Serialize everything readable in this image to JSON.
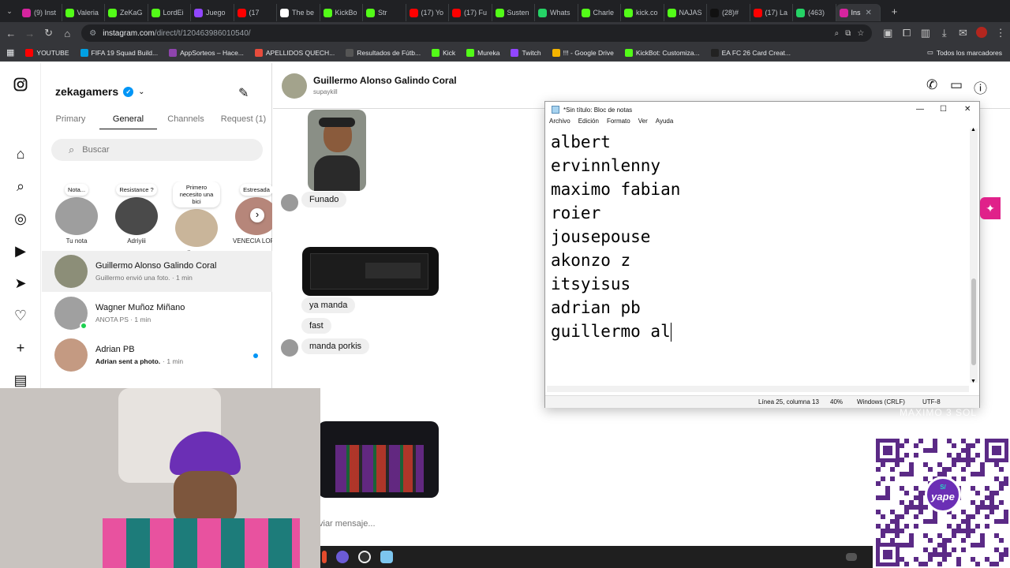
{
  "browser": {
    "tabs": [
      {
        "label": "(9) Inst",
        "color": "#d6249f"
      },
      {
        "label": "Valeria",
        "color": "#53fc18"
      },
      {
        "label": "ZeKaG",
        "color": "#53fc18"
      },
      {
        "label": "LordEi",
        "color": "#53fc18"
      },
      {
        "label": "Juego",
        "color": "#9146ff"
      },
      {
        "label": "(17",
        "color": "#ff0000"
      },
      {
        "label": "The be",
        "color": "#ffffff"
      },
      {
        "label": "KickBo",
        "color": "#53fc18"
      },
      {
        "label": "Str",
        "color": "#53fc18"
      },
      {
        "label": "(17) Yo",
        "color": "#ff0000"
      },
      {
        "label": "(17) Fu",
        "color": "#ff0000"
      },
      {
        "label": "Susten",
        "color": "#53fc18"
      },
      {
        "label": "Whats",
        "color": "#25d366"
      },
      {
        "label": "Charle",
        "color": "#53fc18"
      },
      {
        "label": "kick.co",
        "color": "#53fc18"
      },
      {
        "label": "NAJAS",
        "color": "#53fc18"
      },
      {
        "label": "(28)#",
        "color": "#111111"
      },
      {
        "label": "(17) La",
        "color": "#ff0000"
      },
      {
        "label": "(463)",
        "color": "#25d366"
      },
      {
        "label": "Ins",
        "color": "#d6249f",
        "active": true
      }
    ],
    "url_host": "instagram.com",
    "url_path": "/direct/t/120463986010540/",
    "bookmarks": [
      {
        "label": "YOUTUBE",
        "color": "#ff0000"
      },
      {
        "label": "FIFA 19 Squad Build...",
        "color": "#00a0e3"
      },
      {
        "label": "AppSorteos – Hace...",
        "color": "#8e44ad"
      },
      {
        "label": "APELLIDOS QUECH...",
        "color": "#e74c3c"
      },
      {
        "label": "Resultados de Fútb...",
        "color": "#555555"
      },
      {
        "label": "Kick",
        "color": "#53fc18"
      },
      {
        "label": "Mureka",
        "color": "#53fc18"
      },
      {
        "label": "Twitch",
        "color": "#9146ff"
      },
      {
        "label": "!!! - Google Drive",
        "color": "#f4b400"
      },
      {
        "label": "KickBot: Customiza...",
        "color": "#53fc18"
      },
      {
        "label": "EA FC 26 Card Creat...",
        "color": "#222222"
      }
    ],
    "bookmarks_folder": "Todos los marcadores"
  },
  "inbox": {
    "username": "zekagamers",
    "tabs": [
      "Primary",
      "General",
      "Channels",
      "Request (1)"
    ],
    "active_tab": "General",
    "search_placeholder": "Buscar",
    "notes": [
      {
        "bubble": "Nota...",
        "name": "Tu nota"
      },
      {
        "bubble": "Resistance ?",
        "name": "Adriyiii"
      },
      {
        "bubble": "Primero necesito una bici",
        "name": "milenaxgg"
      },
      {
        "bubble": "Estresada",
        "name": "VENECIA LOPEZ"
      }
    ],
    "conversations": [
      {
        "name": "Guillermo Alonso Galindo Coral",
        "preview": "Guillermo envió una foto. · 1 min",
        "selected": true
      },
      {
        "name": "Wagner Muñoz Miñano",
        "preview": "ANOTA PS · 1 min"
      },
      {
        "name": "Adrian PB",
        "preview": "Adrian sent a photo.",
        "time": "· 1 min",
        "unread": true
      }
    ]
  },
  "chat": {
    "name": "Guillermo Alonso Galindo Coral",
    "handle": "supaykill",
    "messages": [
      "Funado",
      "ya manda",
      "fast",
      "manda porkis"
    ],
    "composer_placeholder": "viar mensaje..."
  },
  "notepad": {
    "title": "*Sin título: Bloc de notas",
    "menu": [
      "Archivo",
      "Edición",
      "Formato",
      "Ver",
      "Ayuda"
    ],
    "lines": [
      "albert",
      "ervinnlenny",
      "maximo fabian",
      "roier",
      "jousepouse",
      "akonzo z",
      "itsyisus",
      "adrian pb",
      "guillermo al"
    ],
    "status_position": "Línea 25, columna 13",
    "status_zoom": "40%",
    "status_eol": "Windows (CRLF)",
    "status_encoding": "UTF-8"
  },
  "overlay": {
    "qr_brand": "yape",
    "qr_currency": "S/",
    "watermark": "MAXIMO 3 SOL"
  }
}
